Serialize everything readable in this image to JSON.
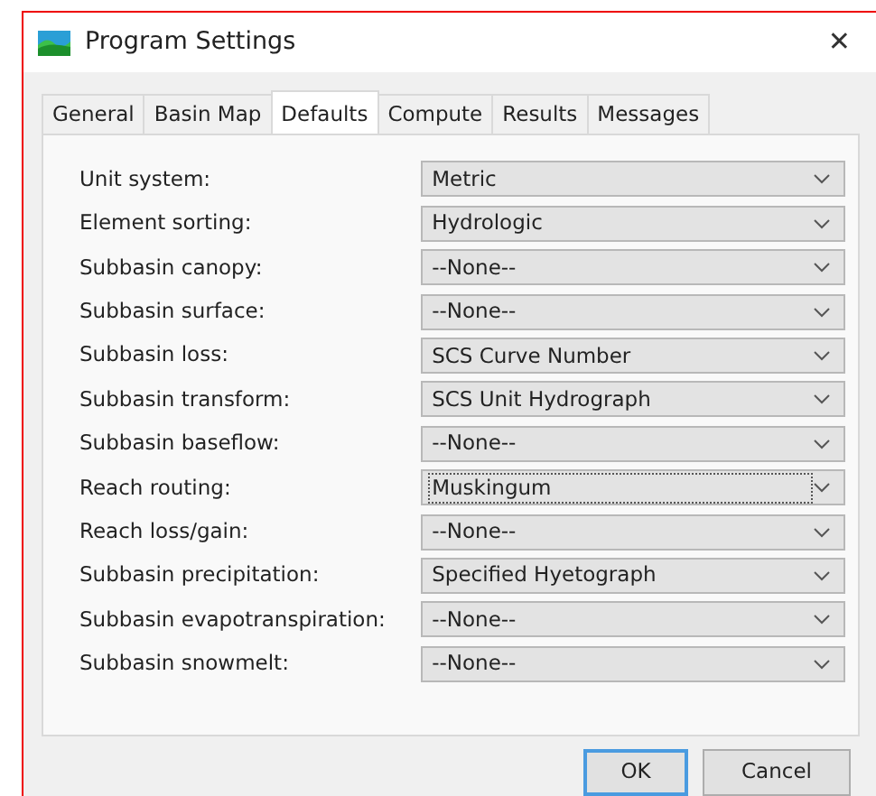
{
  "window": {
    "title": "Program Settings",
    "close": "✕"
  },
  "tabs": [
    {
      "label": "General",
      "selected": false
    },
    {
      "label": "Basin Map",
      "selected": false
    },
    {
      "label": "Defaults",
      "selected": true
    },
    {
      "label": "Compute",
      "selected": false
    },
    {
      "label": "Results",
      "selected": false
    },
    {
      "label": "Messages",
      "selected": false
    }
  ],
  "settings": [
    {
      "label": "Unit system:",
      "value": "Metric",
      "focused": false
    },
    {
      "label": "Element sorting:",
      "value": "Hydrologic",
      "focused": false
    },
    {
      "label": "Subbasin canopy:",
      "value": "--None--",
      "focused": false
    },
    {
      "label": "Subbasin surface:",
      "value": "--None--",
      "focused": false
    },
    {
      "label": "Subbasin loss:",
      "value": "SCS Curve Number",
      "focused": false
    },
    {
      "label": "Subbasin transform:",
      "value": "SCS Unit Hydrograph",
      "focused": false
    },
    {
      "label": "Subbasin baseflow:",
      "value": "--None--",
      "focused": false
    },
    {
      "label": "Reach routing:",
      "value": "Muskingum",
      "focused": true
    },
    {
      "label": "Reach loss/gain:",
      "value": "--None--",
      "focused": false
    },
    {
      "label": "Subbasin precipitation:",
      "value": "Specified Hyetograph",
      "focused": false
    },
    {
      "label": "Subbasin evapotranspiration:",
      "value": "--None--",
      "focused": false
    },
    {
      "label": "Subbasin snowmelt:",
      "value": "--None--",
      "focused": false
    }
  ],
  "buttons": [
    {
      "label": "OK",
      "default": true
    },
    {
      "label": "Cancel",
      "default": false
    }
  ]
}
